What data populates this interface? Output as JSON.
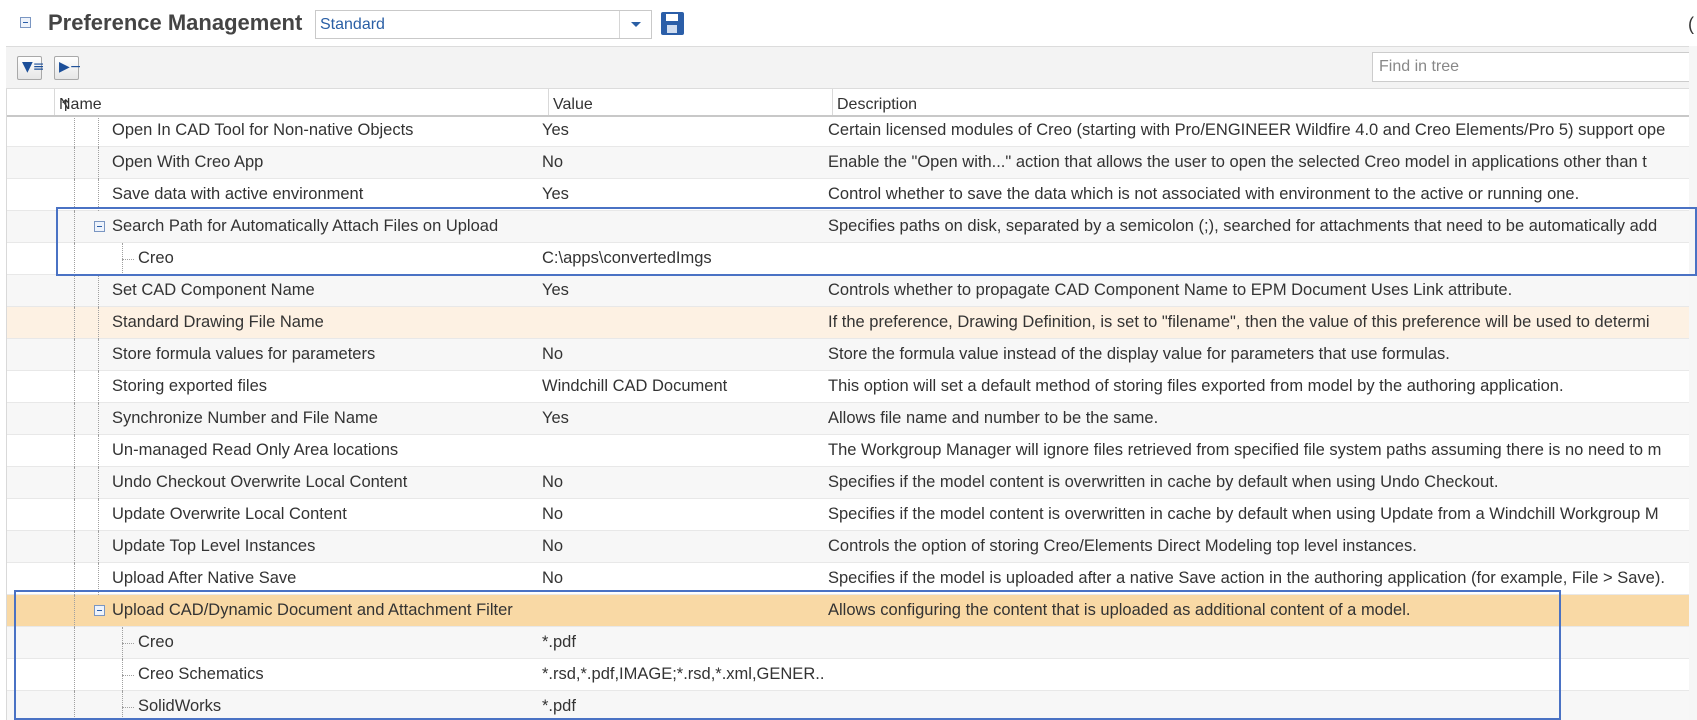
{
  "header": {
    "title": "Preference Management",
    "view_select": "Standard",
    "right_fragment": "("
  },
  "toolbar": {
    "find_placeholder": "Find in tree"
  },
  "icons": {
    "collapse": "collapse-minus-icon",
    "dropdown": "chevron-down-icon",
    "save": "save-floppy-icon",
    "filter": "filter-list-icon",
    "expand_collapse": "expand-tree-icon",
    "sort": "sort-ascending-icon",
    "tree_expander": "tree-collapse-icon"
  },
  "columns": {
    "name": "Name",
    "value": "Value",
    "description": "Description"
  },
  "rows": [
    {
      "name": "Open In CAD Tool for Non-native Objects",
      "value": "Yes",
      "description": "Certain licensed modules of Creo (starting with Pro/ENGINEER Wildfire 4.0 and Creo Elements/Pro 5) support ope"
    },
    {
      "name": "Open With Creo App",
      "value": "No",
      "description": "Enable the \"Open with...\" action that allows the user to open the selected Creo model in applications other than t"
    },
    {
      "name": "Save data with active environment",
      "value": "Yes",
      "description": "Control whether to save the data which is not associated with environment to the active or running one."
    },
    {
      "name": "Search Path for Automatically Attach Files on Upload",
      "value": "",
      "description": "Specifies paths on disk, separated by a semicolon (;), searched for attachments that need to be automatically add"
    },
    {
      "name": "Creo",
      "value": "C:\\apps\\convertedImgs",
      "description": ""
    },
    {
      "name": "Set CAD Component Name",
      "value": "Yes",
      "description": "Controls whether to propagate CAD Component Name to EPM Document Uses Link attribute."
    },
    {
      "name": "Standard Drawing File Name",
      "value": "",
      "description": "If the preference, Drawing Definition, is set to \"filename\", then the value of this preference will be used to determi"
    },
    {
      "name": "Store formula values for parameters",
      "value": "No",
      "description": "Store the formula value instead of the display value for parameters that use formulas."
    },
    {
      "name": "Storing exported files",
      "value": "Windchill CAD Document",
      "description": "This option will set a default method of storing files exported from model by the authoring application."
    },
    {
      "name": "Synchronize Number and File Name",
      "value": "Yes",
      "description": "Allows file name and number to be the same."
    },
    {
      "name": "Un-managed Read Only Area locations",
      "value": "",
      "description": "The Workgroup Manager will ignore files retrieved from specified file system paths assuming there is no need to m"
    },
    {
      "name": "Undo Checkout Overwrite Local Content",
      "value": "No",
      "description": "Specifies if the model content is overwritten in cache by default when using Undo Checkout."
    },
    {
      "name": "Update Overwrite Local Content",
      "value": "No",
      "description": "Specifies if the model content is overwritten in cache by default when using Update from a Windchill Workgroup M"
    },
    {
      "name": "Update Top Level Instances",
      "value": "No",
      "description": "Controls the option of storing Creo/Elements Direct Modeling top level instances."
    },
    {
      "name": "Upload After Native Save",
      "value": "No",
      "description": "Specifies if the model is uploaded after a native Save action in the authoring application (for example, File > Save)."
    },
    {
      "name": "Upload CAD/Dynamic Document and Attachment Filter",
      "value": "",
      "description": "Allows configuring the content that is uploaded as additional content of a model."
    },
    {
      "name": "Creo",
      "value": "*.pdf",
      "description": ""
    },
    {
      "name": "Creo Schematics",
      "value": "*.rsd,*.pdf,IMAGE;*.rsd,*.xml,GENER..",
      "description": ""
    },
    {
      "name": "SolidWorks",
      "value": "*.pdf",
      "description": ""
    }
  ],
  "colors": {
    "accent": "#2b5ea8",
    "highlight_box": "#4a72c4",
    "selected_row": "#f9d9a5",
    "hover_row": "#fdf1e3"
  }
}
